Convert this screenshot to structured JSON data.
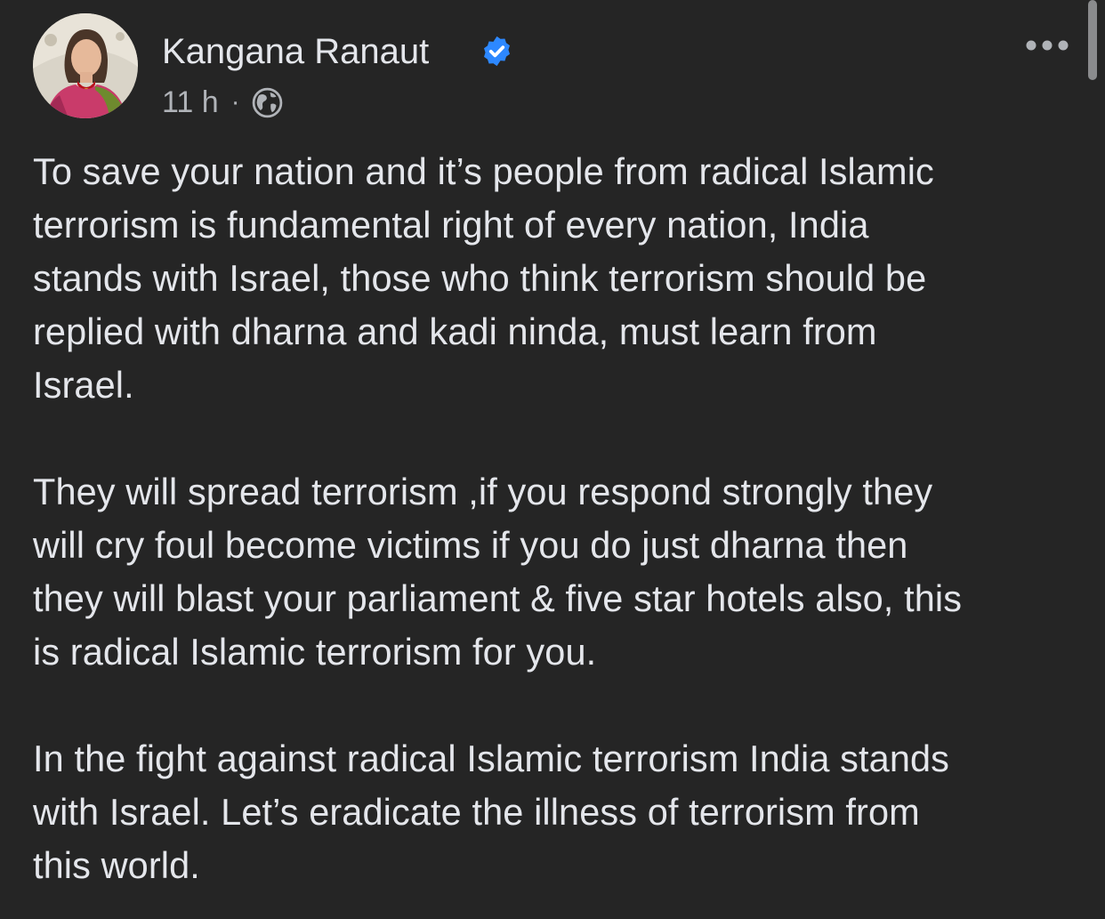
{
  "post": {
    "author": {
      "name": "Kangana Ranaut",
      "verified": true,
      "avatar_icon": "profile-photo"
    },
    "meta": {
      "time": "11 h",
      "separator": "·",
      "audience_icon": "globe-icon"
    },
    "more_icon": "more-options-icon",
    "body": {
      "paragraphs": [
        "To save your nation and it’s people from radical Islamic\nterrorism is fundamental right of every nation, India\nstands with Israel, those  who think terrorism should be\nreplied with dharna and kadi ninda, must learn from\nIsrael.",
        "They will spread terrorism ,if you respond strongly they\nwill cry foul become victims if you do just dharna then\nthey will blast your parliament & five star hotels also, this\nis radical Islamic terrorism for you.",
        "In the fight against  radical Islamic terrorism India stands\nwith Israel. Let’s eradicate the illness of terrorism from\nthis world."
      ]
    }
  },
  "colors": {
    "background": "#252525",
    "primary_text": "#e4e6eb",
    "secondary_text": "#b0b3b8",
    "verified_badge": "#2d88ff"
  }
}
